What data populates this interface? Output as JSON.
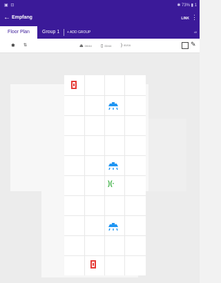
{
  "status": {
    "left": "▣ ⊡",
    "right": "✱ 73% ▮ 1"
  },
  "appbar": {
    "title": "Empfang",
    "action": "LINK"
  },
  "tabs": {
    "floor_plan": "Floor Plan",
    "group1": "Group 1",
    "add_group": "+ ADD GROUP",
    "right_hint": "dif"
  },
  "toolbar": {
    "legend": [
      {
        "icon": "lamp",
        "label": "00/44"
      },
      {
        "icon": "sensor",
        "label": "00/44"
      },
      {
        "icon": "wave",
        "label": "00/16"
      }
    ]
  },
  "floor": {
    "devices": [
      {
        "type": "sensor",
        "color": "#e53935"
      },
      {
        "type": "lamp",
        "color": "#2196f3"
      },
      {
        "type": "lamp",
        "color": "#2196f3"
      },
      {
        "type": "wave",
        "color": "#3cb043"
      },
      {
        "type": "lamp",
        "color": "#2196f3"
      },
      {
        "type": "sensor",
        "color": "#e53935"
      }
    ]
  },
  "colors": {
    "primary": "#3b1a99",
    "sensor": "#e53935",
    "lamp": "#2196f3",
    "wave": "#3cb043"
  }
}
